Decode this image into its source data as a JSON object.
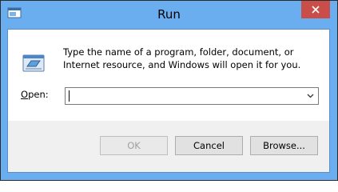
{
  "window": {
    "title": "Run",
    "icon": "run-app-icon",
    "close_icon": "close-icon",
    "close_color": "#c94e4a",
    "titlebar_color": "#6baeef"
  },
  "body": {
    "icon": "run-icon",
    "description": "Type the name of a program, folder, document, or Internet resource, and Windows will open it for you."
  },
  "open_field": {
    "label_mnemonic": "O",
    "label_rest": "pen:",
    "value": "",
    "dropdown_icon": "chevron-down-icon"
  },
  "buttons": {
    "ok": "OK",
    "cancel": "Cancel",
    "browse": "Browse..."
  }
}
